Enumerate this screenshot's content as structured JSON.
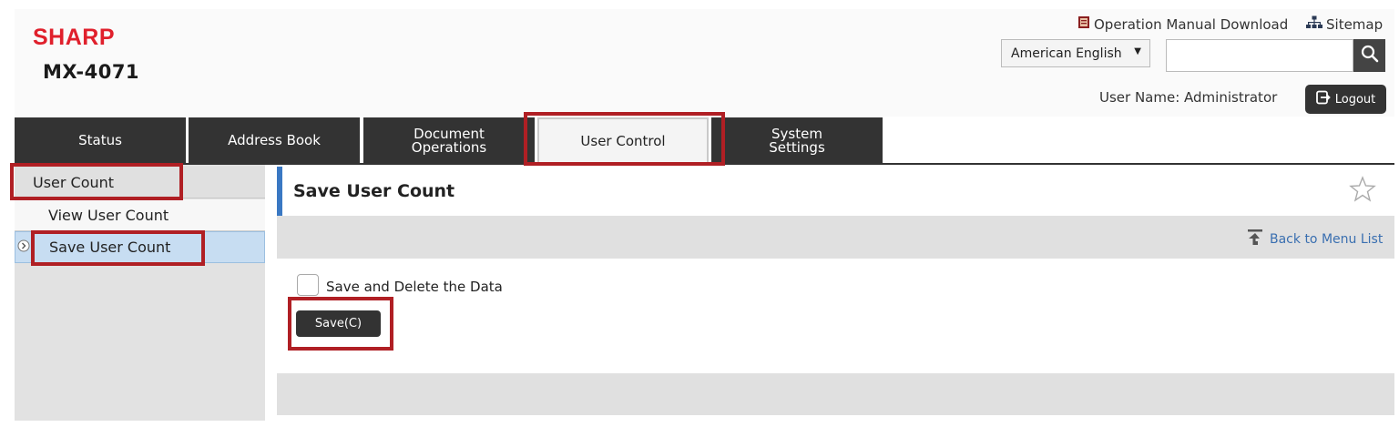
{
  "brand": {
    "logo": "SHARP",
    "model": "MX-4071"
  },
  "header": {
    "manual_link": "Operation Manual Download",
    "sitemap_link": "Sitemap",
    "language": "American English",
    "search": {
      "value": "",
      "placeholder": ""
    },
    "user_name": "User Name: Administrator",
    "logout_label": "Logout"
  },
  "tabs": [
    {
      "label": "Status"
    },
    {
      "label": "Address Book"
    },
    {
      "label": "Document\nOperations"
    },
    {
      "label": "User Control",
      "active": true
    },
    {
      "label": "System\nSettings"
    }
  ],
  "sidebar": {
    "heading": "User Count",
    "items": [
      {
        "label": "View User Count"
      },
      {
        "label": "Save User Count",
        "selected": true
      }
    ]
  },
  "main": {
    "title": "Save User Count",
    "back_link": "Back to Menu List",
    "checkbox_label": "Save and Delete the Data",
    "checkbox_checked": false,
    "save_button": "Save(C)"
  },
  "icons": {
    "manual": "manual-book-icon",
    "sitemap": "sitemap-icon",
    "search": "search-icon",
    "logout": "logout-icon",
    "star": "star-icon",
    "back": "back-to-menu-icon",
    "sidebar_selected": "chevron-circle-right-icon"
  },
  "colors": {
    "brand_red": "#e0202c",
    "dark": "#333333",
    "highlight": "#b01f24",
    "accent_blue": "#3a78c3",
    "selected_bg": "#c7ddf2"
  }
}
